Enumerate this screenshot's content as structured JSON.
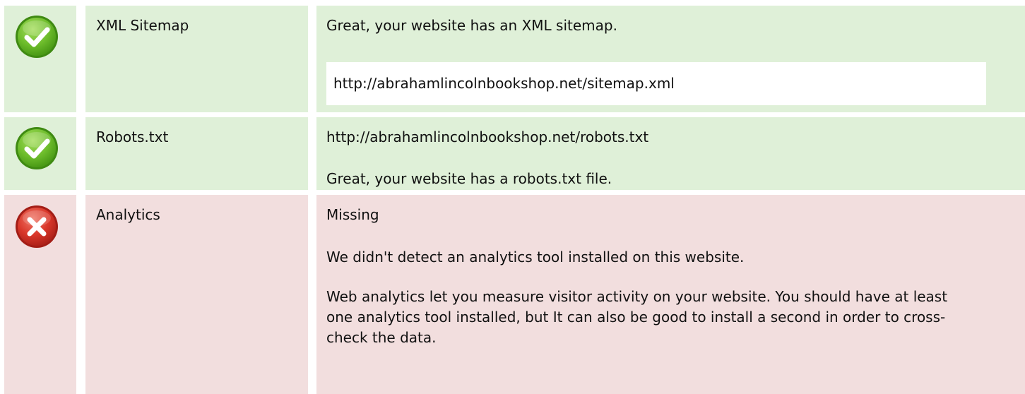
{
  "colors": {
    "pass_background": "#dff0d8",
    "fail_background": "#f2dede"
  },
  "rows": [
    {
      "status": "pass",
      "icon": "check-circle-icon",
      "label": "XML Sitemap",
      "message": "Great, your website has an XML sitemap.",
      "url": "http://abrahamlincolnbookshop.net/sitemap.xml"
    },
    {
      "status": "pass",
      "icon": "check-circle-icon",
      "label": "Robots.txt",
      "url": "http://abrahamlincolnbookshop.net/robots.txt",
      "message": "Great, your website has a robots.txt file."
    },
    {
      "status": "fail",
      "icon": "cross-circle-icon",
      "label": "Analytics",
      "value": "Missing",
      "message": "We didn't detect an analytics tool installed on this website.",
      "detail": "Web analytics let you measure visitor activity on your website. You should have at least one analytics tool installed, but It can also be good to install a second in order to cross-check the data."
    }
  ]
}
